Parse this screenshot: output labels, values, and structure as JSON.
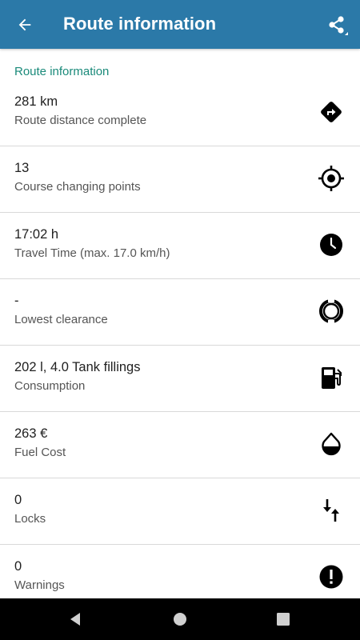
{
  "app_bar": {
    "title": "Route information",
    "back_icon": "arrow-back-icon",
    "share_icon": "share-icon"
  },
  "section": {
    "title": "Route information"
  },
  "items": [
    {
      "value": "281 km",
      "label": "Route distance complete",
      "icon": "route-diamond-icon"
    },
    {
      "value": "13",
      "label": "Course changing points",
      "icon": "crosshair-icon"
    },
    {
      "value": "17:02 h",
      "label": "Travel Time (max. 17.0 km/h)",
      "icon": "clock-icon"
    },
    {
      "value": "-",
      "label": "Lowest clearance",
      "icon": "clearance-ring-icon"
    },
    {
      "value": "202 l, 4.0 Tank fillings",
      "label": "Consumption",
      "icon": "fuel-pump-icon"
    },
    {
      "value": "263 €",
      "label": "Fuel Cost",
      "icon": "fuel-drop-icon"
    },
    {
      "value": "0",
      "label": "Locks",
      "icon": "lock-arrows-icon"
    },
    {
      "value": "0",
      "label": "Warnings",
      "icon": "warning-icon"
    }
  ],
  "nav": {
    "back": "nav-back-icon",
    "home": "nav-home-icon",
    "recents": "nav-recents-icon"
  },
  "colors": {
    "app_bar": "#2b79a8",
    "section_title": "#1a8a7a"
  }
}
